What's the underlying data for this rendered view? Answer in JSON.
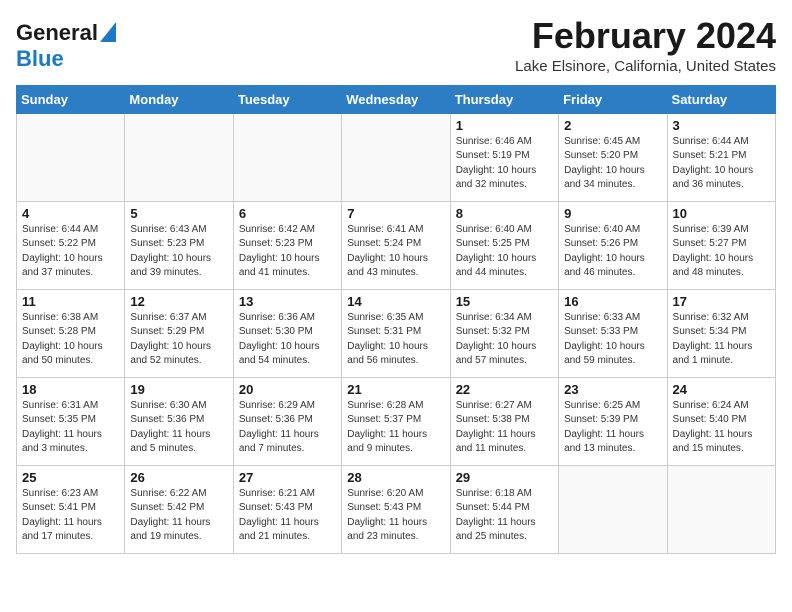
{
  "header": {
    "logo_general": "General",
    "logo_blue": "Blue",
    "main_title": "February 2024",
    "subtitle": "Lake Elsinore, California, United States"
  },
  "weekdays": [
    "Sunday",
    "Monday",
    "Tuesday",
    "Wednesday",
    "Thursday",
    "Friday",
    "Saturday"
  ],
  "weeks": [
    [
      {
        "day": "",
        "info": ""
      },
      {
        "day": "",
        "info": ""
      },
      {
        "day": "",
        "info": ""
      },
      {
        "day": "",
        "info": ""
      },
      {
        "day": "1",
        "info": "Sunrise: 6:46 AM\nSunset: 5:19 PM\nDaylight: 10 hours\nand 32 minutes."
      },
      {
        "day": "2",
        "info": "Sunrise: 6:45 AM\nSunset: 5:20 PM\nDaylight: 10 hours\nand 34 minutes."
      },
      {
        "day": "3",
        "info": "Sunrise: 6:44 AM\nSunset: 5:21 PM\nDaylight: 10 hours\nand 36 minutes."
      }
    ],
    [
      {
        "day": "4",
        "info": "Sunrise: 6:44 AM\nSunset: 5:22 PM\nDaylight: 10 hours\nand 37 minutes."
      },
      {
        "day": "5",
        "info": "Sunrise: 6:43 AM\nSunset: 5:23 PM\nDaylight: 10 hours\nand 39 minutes."
      },
      {
        "day": "6",
        "info": "Sunrise: 6:42 AM\nSunset: 5:23 PM\nDaylight: 10 hours\nand 41 minutes."
      },
      {
        "day": "7",
        "info": "Sunrise: 6:41 AM\nSunset: 5:24 PM\nDaylight: 10 hours\nand 43 minutes."
      },
      {
        "day": "8",
        "info": "Sunrise: 6:40 AM\nSunset: 5:25 PM\nDaylight: 10 hours\nand 44 minutes."
      },
      {
        "day": "9",
        "info": "Sunrise: 6:40 AM\nSunset: 5:26 PM\nDaylight: 10 hours\nand 46 minutes."
      },
      {
        "day": "10",
        "info": "Sunrise: 6:39 AM\nSunset: 5:27 PM\nDaylight: 10 hours\nand 48 minutes."
      }
    ],
    [
      {
        "day": "11",
        "info": "Sunrise: 6:38 AM\nSunset: 5:28 PM\nDaylight: 10 hours\nand 50 minutes."
      },
      {
        "day": "12",
        "info": "Sunrise: 6:37 AM\nSunset: 5:29 PM\nDaylight: 10 hours\nand 52 minutes."
      },
      {
        "day": "13",
        "info": "Sunrise: 6:36 AM\nSunset: 5:30 PM\nDaylight: 10 hours\nand 54 minutes."
      },
      {
        "day": "14",
        "info": "Sunrise: 6:35 AM\nSunset: 5:31 PM\nDaylight: 10 hours\nand 56 minutes."
      },
      {
        "day": "15",
        "info": "Sunrise: 6:34 AM\nSunset: 5:32 PM\nDaylight: 10 hours\nand 57 minutes."
      },
      {
        "day": "16",
        "info": "Sunrise: 6:33 AM\nSunset: 5:33 PM\nDaylight: 10 hours\nand 59 minutes."
      },
      {
        "day": "17",
        "info": "Sunrise: 6:32 AM\nSunset: 5:34 PM\nDaylight: 11 hours\nand 1 minute."
      }
    ],
    [
      {
        "day": "18",
        "info": "Sunrise: 6:31 AM\nSunset: 5:35 PM\nDaylight: 11 hours\nand 3 minutes."
      },
      {
        "day": "19",
        "info": "Sunrise: 6:30 AM\nSunset: 5:36 PM\nDaylight: 11 hours\nand 5 minutes."
      },
      {
        "day": "20",
        "info": "Sunrise: 6:29 AM\nSunset: 5:36 PM\nDaylight: 11 hours\nand 7 minutes."
      },
      {
        "day": "21",
        "info": "Sunrise: 6:28 AM\nSunset: 5:37 PM\nDaylight: 11 hours\nand 9 minutes."
      },
      {
        "day": "22",
        "info": "Sunrise: 6:27 AM\nSunset: 5:38 PM\nDaylight: 11 hours\nand 11 minutes."
      },
      {
        "day": "23",
        "info": "Sunrise: 6:25 AM\nSunset: 5:39 PM\nDaylight: 11 hours\nand 13 minutes."
      },
      {
        "day": "24",
        "info": "Sunrise: 6:24 AM\nSunset: 5:40 PM\nDaylight: 11 hours\nand 15 minutes."
      }
    ],
    [
      {
        "day": "25",
        "info": "Sunrise: 6:23 AM\nSunset: 5:41 PM\nDaylight: 11 hours\nand 17 minutes."
      },
      {
        "day": "26",
        "info": "Sunrise: 6:22 AM\nSunset: 5:42 PM\nDaylight: 11 hours\nand 19 minutes."
      },
      {
        "day": "27",
        "info": "Sunrise: 6:21 AM\nSunset: 5:43 PM\nDaylight: 11 hours\nand 21 minutes."
      },
      {
        "day": "28",
        "info": "Sunrise: 6:20 AM\nSunset: 5:43 PM\nDaylight: 11 hours\nand 23 minutes."
      },
      {
        "day": "29",
        "info": "Sunrise: 6:18 AM\nSunset: 5:44 PM\nDaylight: 11 hours\nand 25 minutes."
      },
      {
        "day": "",
        "info": ""
      },
      {
        "day": "",
        "info": ""
      }
    ]
  ]
}
